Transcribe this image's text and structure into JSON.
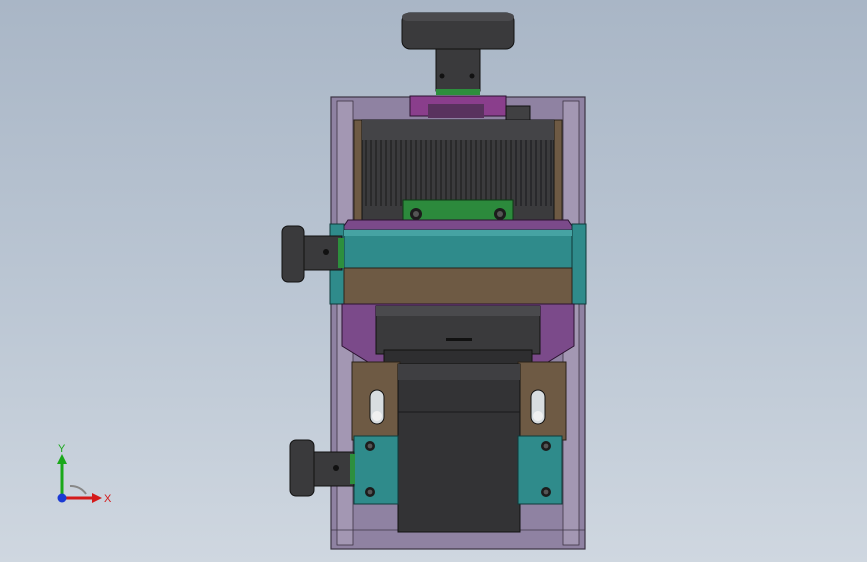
{
  "viewport": {
    "background_top": "#a9b6c6",
    "background_bottom": "#cfd7e0"
  },
  "colors": {
    "frame": "#8c7f9e",
    "frame_dark": "#5d5468",
    "bronze": "#6e5a44",
    "teal": "#2f8b8b",
    "teal_light": "#46a3a3",
    "dark_metal": "#2e2e30",
    "green_plate": "#2c8a3c",
    "magenta": "#8a3e8c",
    "purple_plate": "#7b4a8a"
  },
  "triad": {
    "x_label": "X",
    "y_label": "Y",
    "x_color": "#d41a1a",
    "y_color": "#1aa81a",
    "z_color": "#1a3ad4"
  }
}
